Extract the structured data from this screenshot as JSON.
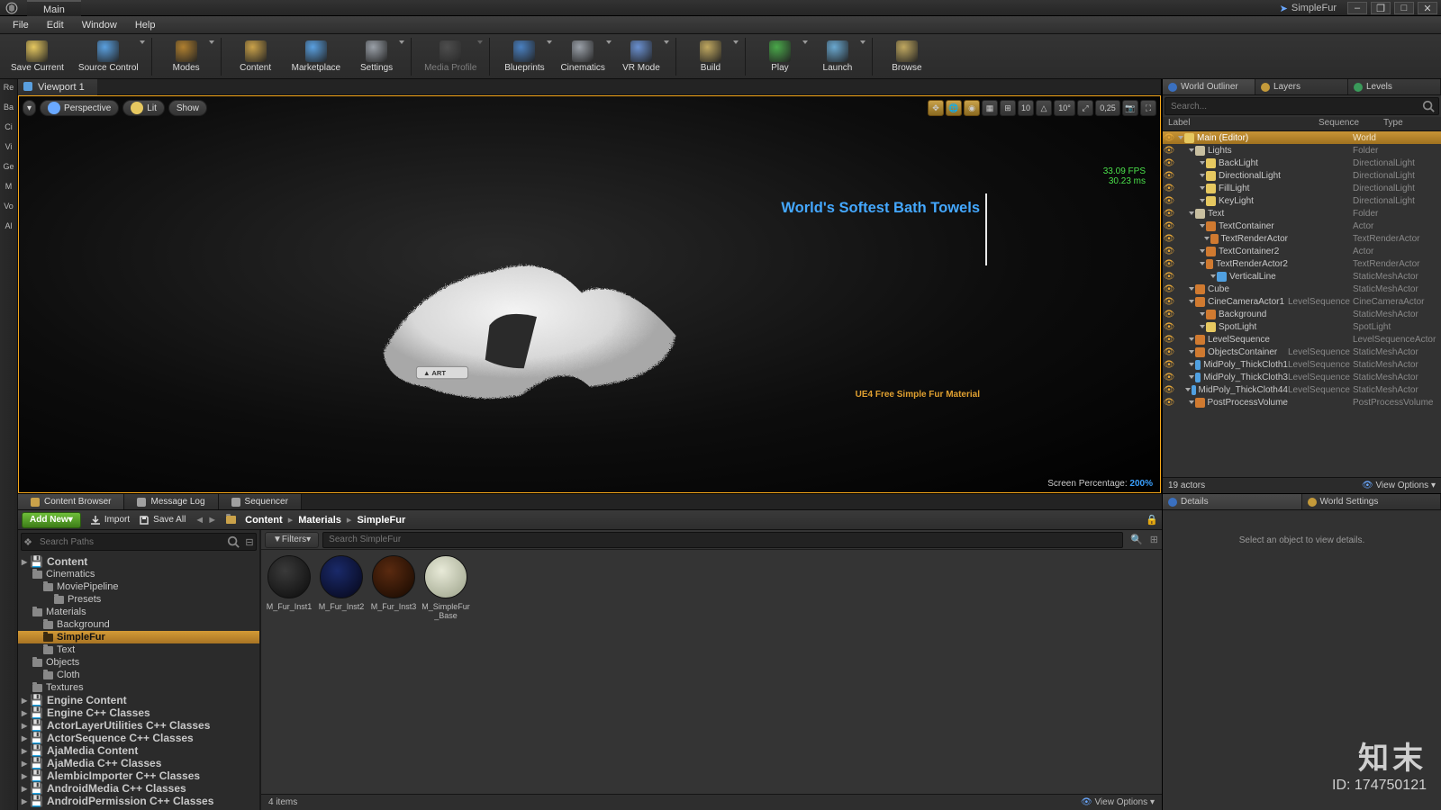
{
  "window": {
    "project": "SimpleFur",
    "main_tab": "Main"
  },
  "menu": [
    "File",
    "Edit",
    "Window",
    "Help"
  ],
  "toolbar": [
    {
      "label": "Save Current",
      "color": "#e6c860"
    },
    {
      "label": "Source Control",
      "color": "#5aa0e0",
      "dd": true
    },
    {
      "label": "Modes",
      "color": "#b08030",
      "dd": true
    },
    {
      "label": "Content",
      "color": "#caa24a"
    },
    {
      "label": "Marketplace",
      "color": "#5aa0e0"
    },
    {
      "label": "Settings",
      "color": "#9aa0a8",
      "dd": true
    },
    {
      "label": "Media Profile",
      "color": "#707070",
      "dim": true,
      "dd": true
    },
    {
      "label": "Blueprints",
      "color": "#4a80c0",
      "dd": true
    },
    {
      "label": "Cinematics",
      "color": "#9aa0a8",
      "dd": true
    },
    {
      "label": "VR Mode",
      "color": "#6a90d0",
      "dd": true
    },
    {
      "label": "Build",
      "color": "#c0a860",
      "dd": true
    },
    {
      "label": "Play",
      "color": "#4aa84a",
      "dd": true
    },
    {
      "label": "Launch",
      "color": "#6aa8d0",
      "dd": true
    },
    {
      "label": "Browse",
      "color": "#c0a860"
    }
  ],
  "leftrail": [
    "Re",
    "Ba",
    "Ci",
    "Vi",
    "Ge",
    "M",
    "Vo",
    "Al"
  ],
  "viewport": {
    "tab": "Viewport 1",
    "buttons": {
      "perspective": "Perspective",
      "lit": "Lit",
      "show": "Show"
    },
    "right_nums": {
      "grid": "10",
      "angle": "10°",
      "scale": "0,25"
    },
    "fps": "33.09 FPS",
    "ms": "30.23 ms",
    "title": "World's Softest Bath Towels",
    "caption": "UE4 Free Simple Fur Material",
    "screen_pct_label": "Screen Percentage:",
    "screen_pct_value": "200%"
  },
  "outliner": {
    "tabs": [
      {
        "l": "World Outliner",
        "c": "#3a70c0"
      },
      {
        "l": "Layers",
        "c": "#c49a3a"
      },
      {
        "l": "Levels",
        "c": "#3a9a5a"
      }
    ],
    "search_placeholder": "Search...",
    "head": {
      "c1": "Label",
      "c2": "Sequence",
      "c3": "Type"
    },
    "rows": [
      {
        "d": 0,
        "l": "Main (Editor)",
        "t": "World",
        "sel": true,
        "c": "#e6c860"
      },
      {
        "d": 1,
        "l": "Lights",
        "t": "Folder",
        "c": "#c8bfa0"
      },
      {
        "d": 2,
        "l": "BackLight",
        "t": "DirectionalLight",
        "c": "#e6c860"
      },
      {
        "d": 2,
        "l": "DirectionalLight",
        "t": "DirectionalLight",
        "c": "#e6c860"
      },
      {
        "d": 2,
        "l": "FillLight",
        "t": "DirectionalLight",
        "c": "#e6c860"
      },
      {
        "d": 2,
        "l": "KeyLight",
        "t": "DirectionalLight",
        "c": "#e6c860"
      },
      {
        "d": 1,
        "l": "Text",
        "t": "Folder",
        "c": "#c8bfa0"
      },
      {
        "d": 2,
        "l": "TextContainer",
        "t": "Actor",
        "c": "#d07a30"
      },
      {
        "d": 3,
        "l": "TextRenderActor",
        "t": "TextRenderActor",
        "c": "#d07a30"
      },
      {
        "d": 2,
        "l": "TextContainer2",
        "t": "Actor",
        "c": "#d07a30"
      },
      {
        "d": 3,
        "l": "TextRenderActor2",
        "t": "TextRenderActor",
        "c": "#d07a30"
      },
      {
        "d": 3,
        "l": "VerticalLine",
        "t": "StaticMeshActor",
        "c": "#50a0e0"
      },
      {
        "d": 1,
        "l": "Cube",
        "t": "StaticMeshActor",
        "c": "#d07a30"
      },
      {
        "d": 1,
        "l": "CineCameraActor1",
        "s": "LevelSequence",
        "t": "CineCameraActor",
        "c": "#d07a30"
      },
      {
        "d": 2,
        "l": "Background",
        "t": "StaticMeshActor",
        "c": "#d07a30"
      },
      {
        "d": 2,
        "l": "SpotLight",
        "t": "SpotLight",
        "c": "#e6c860"
      },
      {
        "d": 1,
        "l": "LevelSequence",
        "t": "LevelSequenceActor",
        "c": "#d07a30"
      },
      {
        "d": 1,
        "l": "ObjectsContainer",
        "s": "LevelSequence",
        "t": "StaticMeshActor",
        "c": "#d07a30"
      },
      {
        "d": 2,
        "l": "MidPoly_ThickCloth1",
        "s": "LevelSequence",
        "t": "StaticMeshActor",
        "c": "#50a0e0"
      },
      {
        "d": 2,
        "l": "MidPoly_ThickCloth3",
        "s": "LevelSequence",
        "t": "StaticMeshActor",
        "c": "#50a0e0"
      },
      {
        "d": 2,
        "l": "MidPoly_ThickCloth44",
        "s": "LevelSequence",
        "t": "StaticMeshActor",
        "c": "#50a0e0"
      },
      {
        "d": 1,
        "l": "PostProcessVolume",
        "t": "PostProcessVolume",
        "c": "#d07a30"
      }
    ],
    "foot_count": "19 actors",
    "foot_view": "View Options"
  },
  "details": {
    "tabs": [
      {
        "l": "Details",
        "c": "#3a70c0"
      },
      {
        "l": "World Settings",
        "c": "#c49a3a"
      }
    ],
    "msg": "Select an object to view details."
  },
  "content_browser": {
    "tabs": [
      {
        "l": "Content Browser",
        "c": "#caa24a",
        "active": true
      },
      {
        "l": "Message Log",
        "c": "#a0a0a0"
      },
      {
        "l": "Sequencer",
        "c": "#a0a0a0"
      }
    ],
    "addnew": "Add New",
    "import": "Import",
    "saveall": "Save All",
    "breadcrumbs": [
      "Content",
      "Materials",
      "SimpleFur"
    ],
    "tree_search_placeholder": "Search Paths",
    "tree": [
      {
        "d": 0,
        "l": "Content",
        "hdr": true
      },
      {
        "d": 1,
        "l": "Cinematics"
      },
      {
        "d": 2,
        "l": "MoviePipeline"
      },
      {
        "d": 3,
        "l": "Presets"
      },
      {
        "d": 1,
        "l": "Materials"
      },
      {
        "d": 2,
        "l": "Background"
      },
      {
        "d": 2,
        "l": "SimpleFur",
        "sel": true
      },
      {
        "d": 2,
        "l": "Text"
      },
      {
        "d": 1,
        "l": "Objects"
      },
      {
        "d": 2,
        "l": "Cloth"
      },
      {
        "d": 1,
        "l": "Textures"
      },
      {
        "d": 0,
        "l": "Engine Content",
        "hdr": true
      },
      {
        "d": 0,
        "l": "Engine C++ Classes",
        "hdr": true
      },
      {
        "d": 0,
        "l": "ActorLayerUtilities C++ Classes",
        "hdr": true
      },
      {
        "d": 0,
        "l": "ActorSequence C++ Classes",
        "hdr": true
      },
      {
        "d": 0,
        "l": "AjaMedia Content",
        "hdr": true
      },
      {
        "d": 0,
        "l": "AjaMedia C++ Classes",
        "hdr": true
      },
      {
        "d": 0,
        "l": "AlembicImporter C++ Classes",
        "hdr": true
      },
      {
        "d": 0,
        "l": "AndroidMedia C++ Classes",
        "hdr": true
      },
      {
        "d": 0,
        "l": "AndroidPermission C++ Classes",
        "hdr": true
      }
    ],
    "filters": "Filters",
    "asset_search_placeholder": "Search SimpleFur",
    "assets": [
      {
        "name": "M_Fur_Inst1",
        "bg": "radial-gradient(circle at 40% 35%, #3a3a3a, #0a0a0a)"
      },
      {
        "name": "M_Fur_Inst2",
        "bg": "radial-gradient(circle at 40% 35%, #1a2a6a, #050515)"
      },
      {
        "name": "M_Fur_Inst3",
        "bg": "radial-gradient(circle at 40% 35%, #5a2a10, #140800)"
      },
      {
        "name": "M_SimpleFur_Base",
        "bg": "radial-gradient(circle at 40% 35%, #e8ead8, #9aa088)"
      }
    ],
    "foot_count": "4 items",
    "foot_view": "View Options"
  },
  "watermark": {
    "brand": "知末",
    "id": "ID: 174750121"
  }
}
